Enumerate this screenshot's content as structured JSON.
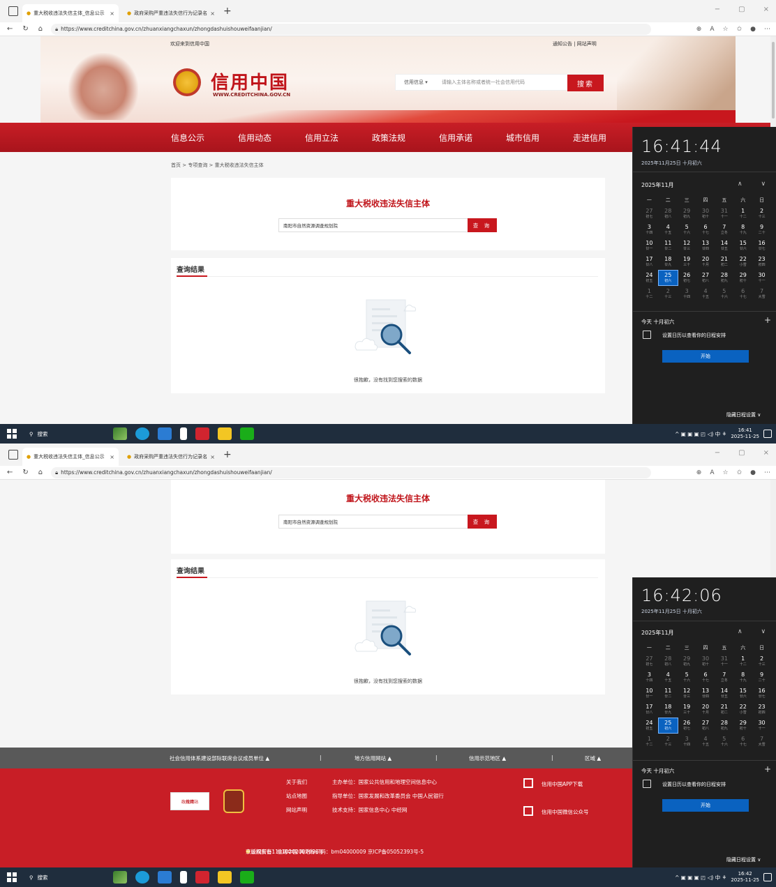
{
  "browser": {
    "tabs": [
      {
        "title": "重大税收违法失信主体_信息公示",
        "close": "×"
      },
      {
        "title": "政府采购严重违法失信行为记录名",
        "close": "×"
      }
    ],
    "new_tab": "+",
    "url": "https://www.creditchina.gov.cn/zhuanxiangchaxun/zhongdashuishouweifaanjian/",
    "controls": {
      "minimize": "−",
      "maximize": "▢",
      "close": "×"
    }
  },
  "site": {
    "welcome": "欢迎来到信用中国",
    "top_links": "通知公告 | 网站声明",
    "logo_cn": "信用中国",
    "logo_en": "WWW.CREDITCHINA.GOV.CN",
    "search_type": "信用信息",
    "search_placeholder": "请输入主体名称或者统一社会信用代码",
    "search_button": "搜索",
    "nav": [
      "信息公示",
      "信用动态",
      "信用立法",
      "政策法规",
      "信用承诺",
      "城市信用",
      "走进信用"
    ],
    "breadcrumb": "首页 > 专项查询 > 重大税收违法失信主体"
  },
  "query": {
    "title": "重大税收违法失信主体",
    "input_value": "南阳市自然资源调查规划院",
    "button": "查 询"
  },
  "results": {
    "title": "查询结果",
    "empty_text": "很抱歉，没有找到您搜索的数据"
  },
  "footer": {
    "gray": [
      "社会信用体系建设部际联席会议成员单位 ▲",
      "|",
      "地方信用网站 ▲",
      "|",
      "信用示范地区 ▲",
      "|",
      "区域 ▲"
    ],
    "links": [
      "关于我们",
      "站点地图",
      "网站声明"
    ],
    "info": [
      "主办单位：国家公共信用和地理空间信息中心",
      "指导单位：国家发展和改革委员会 中国人民银行",
      "技术支持：国家信息中心 中经网"
    ],
    "badge1": [
      "政府网站",
      "找错"
    ],
    "app": "信用中国APP下载",
    "wechat": "信用中国微信公众号",
    "copyright": "©版权所有：信用中国 网站标识码：bm04000009 京ICP备05052393号-5 ",
    "police": "京公网安备11010202007696号"
  },
  "taskbar": {
    "search": "搜索",
    "tray_icons": "^ ▣ ▣ ▣ ◰ ◁) 中 ⚘",
    "clock1_time": "16:41",
    "clock2_time": "16:42",
    "date": "2025-11-25"
  },
  "calendar": {
    "time1": "16:41:44",
    "time2": "16:42:06",
    "date_line": "2025年11月25日 十月初六",
    "month": "2025年11月",
    "arrows": "∧ ∨",
    "weekdays": [
      "一",
      "二",
      "三",
      "四",
      "五",
      "六",
      "日"
    ],
    "days": [
      {
        "d": "27",
        "l": "初七",
        "dim": true
      },
      {
        "d": "28",
        "l": "初八",
        "dim": true
      },
      {
        "d": "29",
        "l": "初九",
        "dim": true
      },
      {
        "d": "30",
        "l": "初十",
        "dim": true
      },
      {
        "d": "31",
        "l": "十一",
        "dim": true
      },
      {
        "d": "1",
        "l": "十二"
      },
      {
        "d": "2",
        "l": "十三"
      },
      {
        "d": "3",
        "l": "十四"
      },
      {
        "d": "4",
        "l": "十五"
      },
      {
        "d": "5",
        "l": "十六"
      },
      {
        "d": "6",
        "l": "十七"
      },
      {
        "d": "7",
        "l": "立冬"
      },
      {
        "d": "8",
        "l": "十九"
      },
      {
        "d": "9",
        "l": "二十"
      },
      {
        "d": "10",
        "l": "廿一"
      },
      {
        "d": "11",
        "l": "廿二"
      },
      {
        "d": "12",
        "l": "廿三"
      },
      {
        "d": "13",
        "l": "廿四"
      },
      {
        "d": "14",
        "l": "廿五"
      },
      {
        "d": "15",
        "l": "廿六"
      },
      {
        "d": "16",
        "l": "廿七"
      },
      {
        "d": "17",
        "l": "廿八"
      },
      {
        "d": "18",
        "l": "廿九"
      },
      {
        "d": "19",
        "l": "三十"
      },
      {
        "d": "20",
        "l": "十月"
      },
      {
        "d": "21",
        "l": "初二"
      },
      {
        "d": "22",
        "l": "小雪"
      },
      {
        "d": "23",
        "l": "初四"
      },
      {
        "d": "24",
        "l": "初五"
      },
      {
        "d": "25",
        "l": "初六",
        "today": true
      },
      {
        "d": "26",
        "l": "初七"
      },
      {
        "d": "27",
        "l": "初八"
      },
      {
        "d": "28",
        "l": "初九"
      },
      {
        "d": "29",
        "l": "初十"
      },
      {
        "d": "30",
        "l": "十一"
      },
      {
        "d": "1",
        "l": "十二",
        "dim": true
      },
      {
        "d": "2",
        "l": "十三",
        "dim": true
      },
      {
        "d": "3",
        "l": "十四",
        "dim": true
      },
      {
        "d": "4",
        "l": "十五",
        "dim": true
      },
      {
        "d": "5",
        "l": "十六",
        "dim": true
      },
      {
        "d": "6",
        "l": "十七",
        "dim": true
      },
      {
        "d": "7",
        "l": "大雪",
        "dim": true
      }
    ],
    "today_label": "今天 十月初六",
    "plus": "+",
    "setup_text": "设置日历以查看你的日程安排",
    "start_button": "开始",
    "hide": "隐藏日程设置 ∨"
  },
  "colors": {
    "brand_red": "#c8171e",
    "accent_blue": "#0a62c0"
  }
}
